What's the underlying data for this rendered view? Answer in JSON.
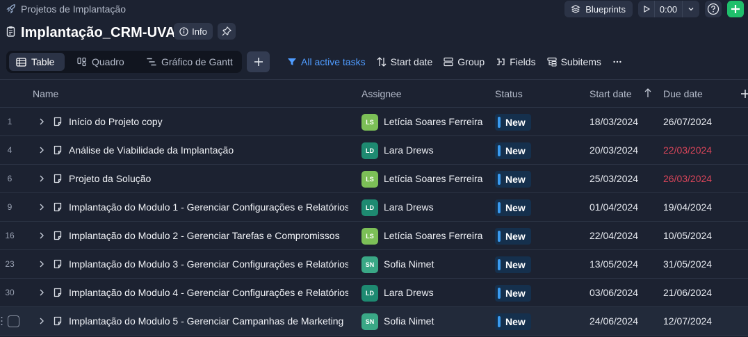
{
  "breadcrumb": {
    "label": "Projetos de Implantação"
  },
  "topbar": {
    "blueprints_label": "Blueprints",
    "timer_value": "0:00"
  },
  "project": {
    "title": "Implantação_CRM-UVA",
    "info_label": "Info"
  },
  "views": [
    {
      "label": "Table",
      "active": true
    },
    {
      "label": "Quadro",
      "active": false
    },
    {
      "label": "Gráfico de Gantt",
      "active": false
    }
  ],
  "toolbar": {
    "filter_label": "All active tasks",
    "sort_label": "Start date",
    "group_label": "Group",
    "fields_label": "Fields",
    "subitems_label": "Subitems"
  },
  "columns": {
    "name": "Name",
    "assignee": "Assignee",
    "status": "Status",
    "start": "Start date",
    "due": "Due date"
  },
  "rows": [
    {
      "num": "1",
      "name": "Início do Projeto copy",
      "initials": "LS",
      "avatar_color": "#7cbf57",
      "assignee": "Letícia Soares Ferreira",
      "status": "New",
      "start": "18/03/2024",
      "due": "26/07/2024",
      "late": false
    },
    {
      "num": "4",
      "name": "Análise de Viabilidade da Implantação",
      "initials": "LD",
      "avatar_color": "#1e8a71",
      "assignee": "Lara Drews",
      "status": "New",
      "start": "20/03/2024",
      "due": "22/03/2024",
      "late": true
    },
    {
      "num": "6",
      "name": "Projeto da Solução",
      "initials": "LS",
      "avatar_color": "#7cbf57",
      "assignee": "Letícia Soares Ferreira",
      "status": "New",
      "start": "25/03/2024",
      "due": "26/03/2024",
      "late": true
    },
    {
      "num": "9",
      "name": "Implantação do Modulo 1 - Gerenciar Configurações e Relatórios",
      "initials": "LD",
      "avatar_color": "#1e8a71",
      "assignee": "Lara Drews",
      "status": "New",
      "start": "01/04/2024",
      "due": "19/04/2024",
      "late": false
    },
    {
      "num": "16",
      "name": "Implantação do Modulo 2 - Gerenciar Tarefas e Compromissos",
      "initials": "LS",
      "avatar_color": "#7cbf57",
      "assignee": "Letícia Soares Ferreira",
      "status": "New",
      "start": "22/04/2024",
      "due": "10/05/2024",
      "late": false
    },
    {
      "num": "23",
      "name": "Implantação do Modulo 3 - Gerenciar Configurações e Relatórios",
      "initials": "SN",
      "avatar_color": "#3aa886",
      "assignee": "Sofia Nimet",
      "status": "New",
      "start": "13/05/2024",
      "due": "31/05/2024",
      "late": false
    },
    {
      "num": "30",
      "name": "Implantação do Modulo 4 - Gerenciar Configurações e Relatórios",
      "initials": "LD",
      "avatar_color": "#1e8a71",
      "assignee": "Lara Drews",
      "status": "New",
      "start": "03/06/2024",
      "due": "21/06/2024",
      "late": false
    },
    {
      "num": "",
      "name": "Implantação do Modulo 5 - Gerenciar Campanhas de Marketing",
      "initials": "SN",
      "avatar_color": "#3aa886",
      "assignee": "Sofia Nimet",
      "status": "New",
      "start": "24/06/2024",
      "due": "12/07/2024",
      "late": false,
      "highlight": true
    }
  ],
  "colors": {
    "accent": "#4f9cff",
    "status_bg": "#15304d",
    "late": "#d9455a",
    "add_green": "#1fbf6b"
  }
}
